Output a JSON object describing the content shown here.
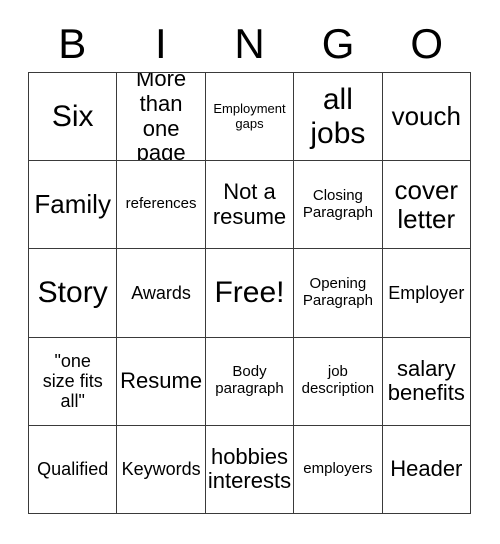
{
  "card": {
    "header_letters": [
      "B",
      "I",
      "N",
      "G",
      "O"
    ],
    "border_color": "#3a3a3a",
    "background_color": "#ffffff",
    "text_color": "#000000",
    "rows": [
      [
        {
          "label": "Six",
          "size": "fs-xl"
        },
        {
          "label": "More\nthan one\npage",
          "size": "fs-md"
        },
        {
          "label": "Employment\ngaps",
          "size": "fs-xxs"
        },
        {
          "label": "all\njobs",
          "size": "fs-xl"
        },
        {
          "label": "vouch",
          "size": "fs-lg"
        }
      ],
      [
        {
          "label": "Family",
          "size": "fs-lg"
        },
        {
          "label": "references",
          "size": "fs-xs"
        },
        {
          "label": "Not a\nresume",
          "size": "fs-md"
        },
        {
          "label": "Closing\nParagraph",
          "size": "fs-xs"
        },
        {
          "label": "cover\nletter",
          "size": "fs-lg"
        }
      ],
      [
        {
          "label": "Story",
          "size": "fs-xl"
        },
        {
          "label": "Awards",
          "size": "fs-sm"
        },
        {
          "label": "Free!",
          "size": "fs-xl"
        },
        {
          "label": "Opening\nParagraph",
          "size": "fs-xs"
        },
        {
          "label": "Employer",
          "size": "fs-sm"
        }
      ],
      [
        {
          "label": "\"one\nsize fits\nall\"",
          "size": "fs-sm"
        },
        {
          "label": "Resume",
          "size": "fs-md"
        },
        {
          "label": "Body\nparagraph",
          "size": "fs-xs"
        },
        {
          "label": "job\ndescription",
          "size": "fs-xs"
        },
        {
          "label": "salary\nbenefits",
          "size": "fs-md"
        }
      ],
      [
        {
          "label": "Qualified",
          "size": "fs-sm"
        },
        {
          "label": "Keywords",
          "size": "fs-sm"
        },
        {
          "label": "hobbies\ninterests",
          "size": "fs-md"
        },
        {
          "label": "employers",
          "size": "fs-xs"
        },
        {
          "label": "Header",
          "size": "fs-md"
        }
      ]
    ]
  }
}
